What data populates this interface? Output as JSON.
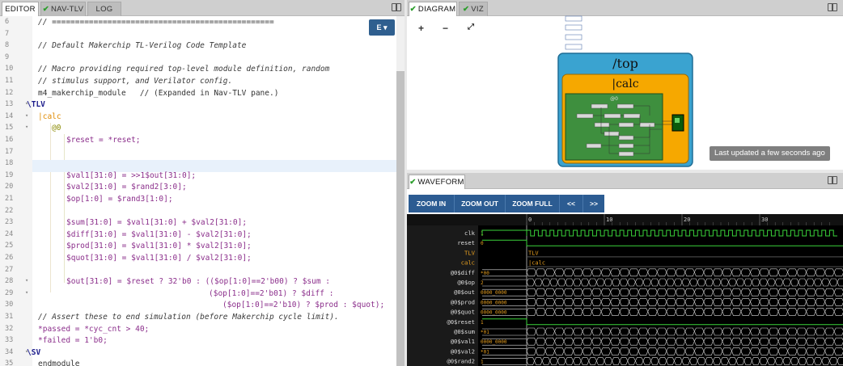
{
  "editor": {
    "tabs": [
      {
        "label": "EDITOR",
        "check": false
      },
      {
        "label": "NAV-TLV",
        "check": true
      },
      {
        "label": "LOG",
        "check": false
      }
    ],
    "dropdown_label": "E ▾",
    "lines": [
      {
        "n": "6",
        "fold": false,
        "text": "// ================================================"
      },
      {
        "n": "7",
        "fold": false,
        "text": ""
      },
      {
        "n": "8",
        "fold": false,
        "text": "// Default Makerchip TL-Verilog Code Template"
      },
      {
        "n": "9",
        "fold": false,
        "text": ""
      },
      {
        "n": "10",
        "fold": false,
        "text": "// Macro providing required top-level module definition, random"
      },
      {
        "n": "11",
        "fold": false,
        "text": "// stimulus support, and Verilator config."
      },
      {
        "n": "12",
        "fold": false,
        "text": "m4_makerchip_module   // (Expanded in Nav-TLV pane.)"
      },
      {
        "n": "13",
        "fold": true,
        "text": "\\TLV"
      },
      {
        "n": "14",
        "fold": true,
        "text": "|calc"
      },
      {
        "n": "15",
        "fold": true,
        "text": "@0"
      },
      {
        "n": "16",
        "fold": false,
        "text": "$reset = *reset;"
      },
      {
        "n": "17",
        "fold": false,
        "text": ""
      },
      {
        "n": "18",
        "fold": false,
        "text": ""
      },
      {
        "n": "19",
        "fold": false,
        "text": "$val1[31:0] = >>1$out[31:0];"
      },
      {
        "n": "20",
        "fold": false,
        "text": "$val2[31:0] = $rand2[3:0];"
      },
      {
        "n": "21",
        "fold": false,
        "text": "$op[1:0] = $rand3[1:0];"
      },
      {
        "n": "22",
        "fold": false,
        "text": ""
      },
      {
        "n": "23",
        "fold": false,
        "text": "$sum[31:0] = $val1[31:0] + $val2[31:0];"
      },
      {
        "n": "24",
        "fold": false,
        "text": "$diff[31:0] = $val1[31:0] - $val2[31:0];"
      },
      {
        "n": "25",
        "fold": false,
        "text": "$prod[31:0] = $val1[31:0] * $val2[31:0];"
      },
      {
        "n": "26",
        "fold": false,
        "text": "$quot[31:0] = $val1[31:0] / $val2[31:0];"
      },
      {
        "n": "27",
        "fold": false,
        "text": ""
      },
      {
        "n": "28",
        "fold": true,
        "text": "$out[31:0] = $reset ? 32'b0 : (($op[1:0]==2'b00) ? $sum :"
      },
      {
        "n": "29",
        "fold": true,
        "text": "($op[1:0]==2'b01) ? $diff :"
      },
      {
        "n": "30",
        "fold": false,
        "text": "($op[1:0]==2'b10) ? $prod : $quot);"
      },
      {
        "n": "31",
        "fold": false,
        "text": "// Assert these to end simulation (before Makerchip cycle limit)."
      },
      {
        "n": "32",
        "fold": false,
        "text": "*passed = *cyc_cnt > 40;"
      },
      {
        "n": "33",
        "fold": false,
        "text": "*failed = 1'b0;"
      },
      {
        "n": "34",
        "fold": true,
        "text": "\\SV"
      },
      {
        "n": "35",
        "fold": false,
        "text": "endmodule"
      }
    ]
  },
  "diagram": {
    "tabs": [
      {
        "label": "DIAGRAM",
        "check": true
      },
      {
        "label": "VIZ",
        "check": true
      }
    ],
    "zoom_in": "+",
    "zoom_out": "−",
    "fit": "⤢",
    "top_label": "/top",
    "calc_label": "|calc",
    "stage_label": "@0",
    "last_updated": "Last updated a few seconds ago"
  },
  "waveform": {
    "tab": {
      "label": "WAVEFORM",
      "check": true
    },
    "buttons": [
      "ZOOM IN",
      "ZOOM OUT",
      "ZOOM FULL",
      "<<",
      ">>"
    ],
    "ticks": [
      "0",
      "10",
      "20",
      "30"
    ],
    "signals": [
      {
        "name": "clk",
        "value": "1"
      },
      {
        "name": "reset",
        "value": "0"
      },
      {
        "name": "TLV",
        "value": ""
      },
      {
        "name": "calc",
        "value": ""
      },
      {
        "name": "@0$diff",
        "value": "*00"
      },
      {
        "name": "@0$op",
        "value": "2"
      },
      {
        "name": "@0$out",
        "value": "0000_0000"
      },
      {
        "name": "@0$prod",
        "value": "0000_0000"
      },
      {
        "name": "@0$quot",
        "value": "0000_0000"
      },
      {
        "name": "@0$reset",
        "value": "1"
      },
      {
        "name": "@0$sum",
        "value": "*01"
      },
      {
        "name": "@0$val1",
        "value": "0000_0000"
      },
      {
        "name": "@0$val2",
        "value": "*01"
      },
      {
        "name": "@0$rand2",
        "value": "1"
      }
    ],
    "scope_tlv": "TLV",
    "scope_calc": "|calc"
  }
}
